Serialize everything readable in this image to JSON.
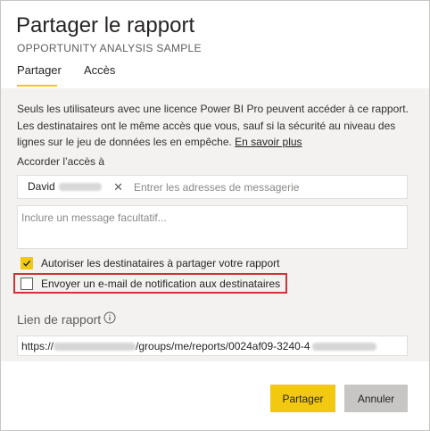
{
  "dialog": {
    "title": "Partager le rapport",
    "subtitle": "OPPORTUNITY ANALYSIS SAMPLE"
  },
  "tabs": [
    {
      "label": "Partager",
      "active": true
    },
    {
      "label": "Accès",
      "active": false
    }
  ],
  "description": {
    "text": "Seuls les utilisateurs avec une licence Power BI Pro peuvent accéder à ce rapport. Les destinataires ont le même accès que vous, sauf si la sécurité au niveau des lignes sur le jeu de données les en empêche. ",
    "link": "En savoir plus"
  },
  "access": {
    "label": "Accorder l’accès à",
    "chip_name": "David",
    "chip_remove": "✕",
    "input_placeholder": "Entrer les adresses de messagerie"
  },
  "message": {
    "placeholder": "Inclure un message facultatif..."
  },
  "options": [
    {
      "label": "Autoriser les destinataires à partager votre rapport",
      "checked": true
    },
    {
      "label": "Envoyer un e-mail de notification aux destinataires",
      "checked": false
    }
  ],
  "report_link": {
    "label": "Lien de rapport",
    "icon": "info-icon",
    "prefix": "https://",
    "path": "/groups/me/reports/0024af09-3240-4"
  },
  "buttons": {
    "share": "Partager",
    "cancel": "Annuler"
  },
  "colors": {
    "accent": "#f2c811",
    "highlight_border": "#d13438",
    "panel_bg": "#f3f2f1"
  }
}
